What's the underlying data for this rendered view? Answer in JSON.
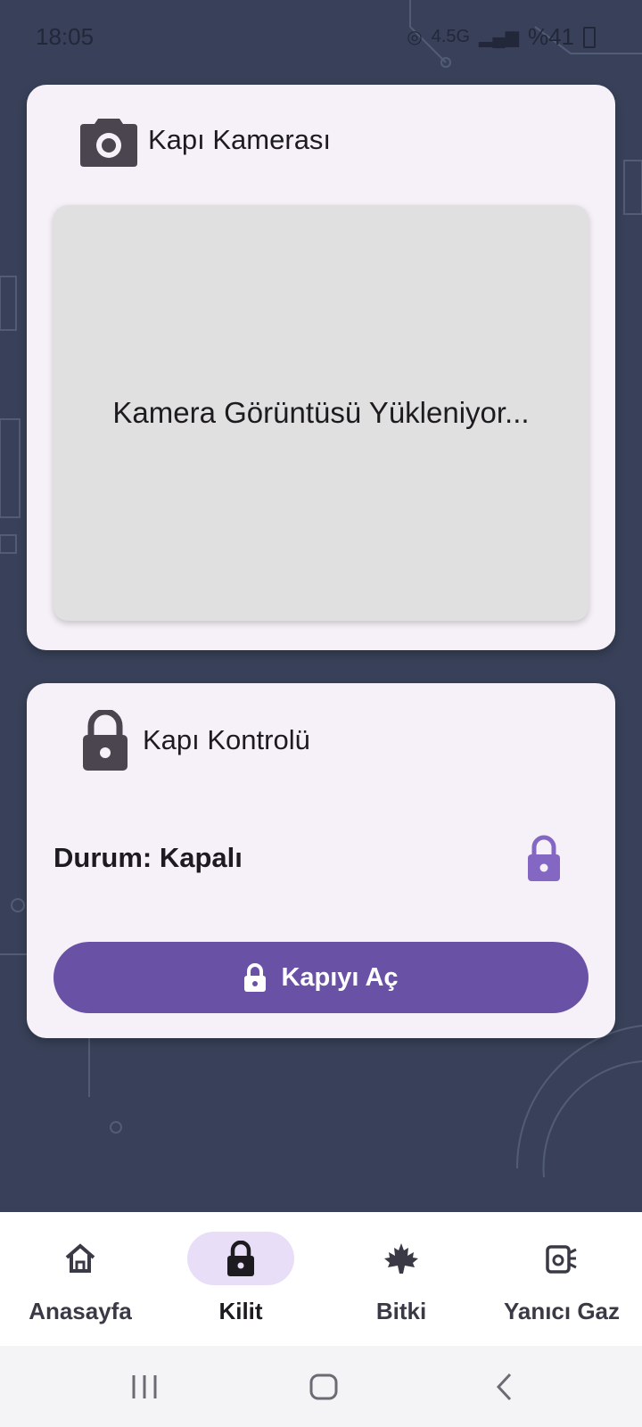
{
  "status_bar": {
    "time": "18:05",
    "battery": "%41",
    "network": "4.5G"
  },
  "camera_card": {
    "title": "Kapı Kamerası",
    "icon": "camera-icon",
    "placeholder": "Kamera Görüntüsü Yükleniyor..."
  },
  "control_card": {
    "title": "Kapı Kontrolü",
    "icon": "lock-icon",
    "status_label": "Durum: Kapalı",
    "status_icon": "lock-closed-icon",
    "open_button_label": "Kapıyı Aç"
  },
  "bottom_nav": {
    "items": [
      {
        "label": "Anasayfa",
        "icon": "home-icon",
        "active": false
      },
      {
        "label": "Kilit",
        "icon": "lock-icon",
        "active": true
      },
      {
        "label": "Bitki",
        "icon": "leaf-icon",
        "active": false
      },
      {
        "label": "Yanıcı Gaz",
        "icon": "gas-icon",
        "active": false
      }
    ]
  },
  "colors": {
    "background": "#384159",
    "card": "#f6f1f8",
    "accent": "#6951a6",
    "active_nav": "#e8def8",
    "status_lock": "#8467c2"
  }
}
